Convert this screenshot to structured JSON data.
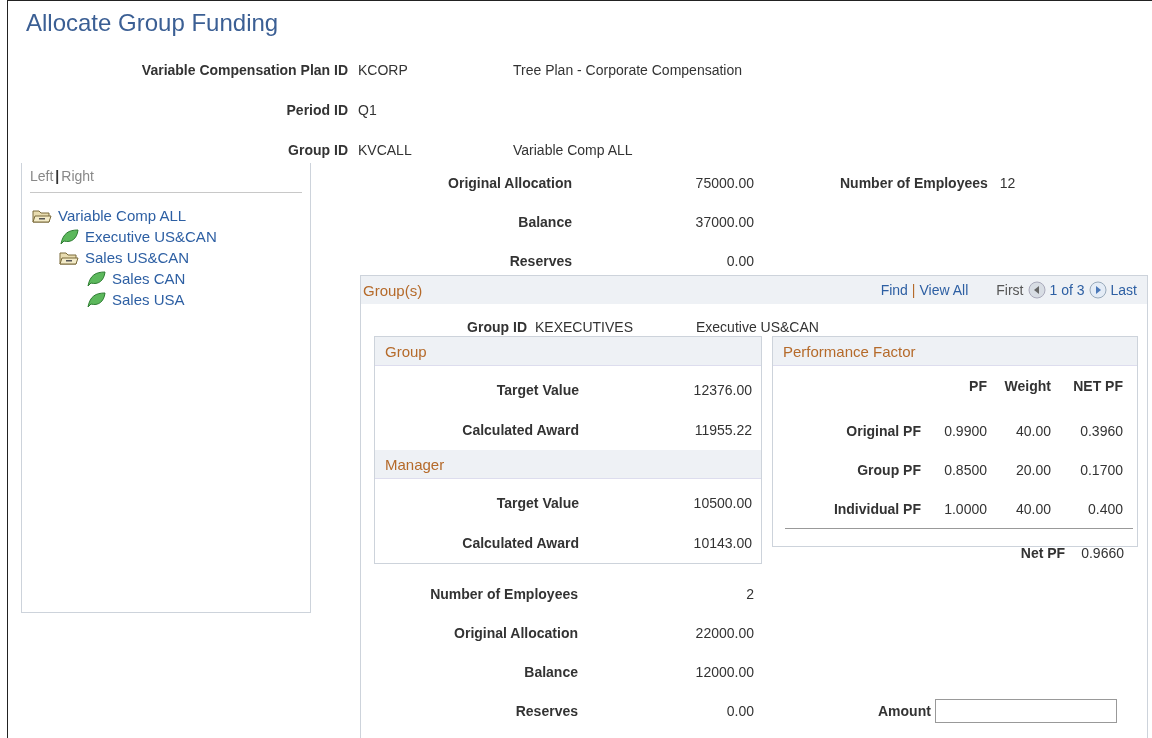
{
  "page_title": "Allocate Group Funding",
  "header_fields": [
    {
      "label": "Variable Compensation Plan ID",
      "value": "KCORP",
      "description": "Tree Plan - Corporate Compensation"
    },
    {
      "label": "Period ID",
      "value": "Q1"
    },
    {
      "label": "Group ID",
      "value": "KVCALL",
      "description": "Variable Comp ALL"
    }
  ],
  "tree_panel": {
    "toggle": {
      "left": "Left",
      "separator": "|",
      "right": "Right"
    },
    "tree": [
      {
        "label": "Variable Comp ALL",
        "kind": "folder",
        "children": [
          {
            "label": "Executive US&CAN",
            "kind": "leaf"
          },
          {
            "label": "Sales US&CAN",
            "kind": "folder",
            "children": [
              {
                "label": "Sales CAN",
                "kind": "leaf"
              },
              {
                "label": "Sales USA",
                "kind": "leaf"
              }
            ]
          }
        ]
      }
    ]
  },
  "summary": {
    "rows": [
      {
        "label": "Original Allocation",
        "value": "75000.00"
      },
      {
        "label": "Balance",
        "value": "37000.00"
      },
      {
        "label": "Reserves",
        "value": "0.00"
      }
    ],
    "employees": {
      "label": "Number of Employees",
      "value": "12"
    }
  },
  "groups": {
    "title": "Group(s)",
    "nav": {
      "find": "Find",
      "separator": "|",
      "view_all": "View All",
      "first": "First",
      "position": "1 of 3",
      "last": "Last"
    },
    "group_id": {
      "label": "Group ID",
      "value": "KEXECUTIVES",
      "description": "Executive US&CAN"
    },
    "sections": [
      {
        "title": "Group",
        "rows": [
          {
            "label": "Target Value",
            "value": "12376.00"
          },
          {
            "label": "Calculated Award",
            "value": "11955.22"
          }
        ]
      },
      {
        "title": "Manager",
        "rows": [
          {
            "label": "Target Value",
            "value": "10500.00"
          },
          {
            "label": "Calculated Award",
            "value": "10143.00"
          }
        ]
      }
    ],
    "performance_factor": {
      "title": "Performance Factor",
      "columns": [
        "PF",
        "Weight",
        "NET PF"
      ],
      "rows": [
        {
          "label": "Original PF",
          "values": [
            "0.9900",
            "40.00",
            "0.3960"
          ]
        },
        {
          "label": "Group PF",
          "values": [
            "0.8500",
            "20.00",
            "0.1700"
          ]
        },
        {
          "label": "Individual PF",
          "values": [
            "1.0000",
            "40.00",
            "0.400"
          ]
        }
      ],
      "total": {
        "label": "Net PF",
        "value": "0.9660"
      }
    },
    "totals": [
      {
        "label": "Number of Employees",
        "value": "2"
      },
      {
        "label": "Original Allocation",
        "value": "22000.00"
      },
      {
        "label": "Balance",
        "value": "12000.00"
      },
      {
        "label": "Reserves",
        "value": "0.00"
      }
    ],
    "amount": {
      "label": "Amount"
    }
  }
}
